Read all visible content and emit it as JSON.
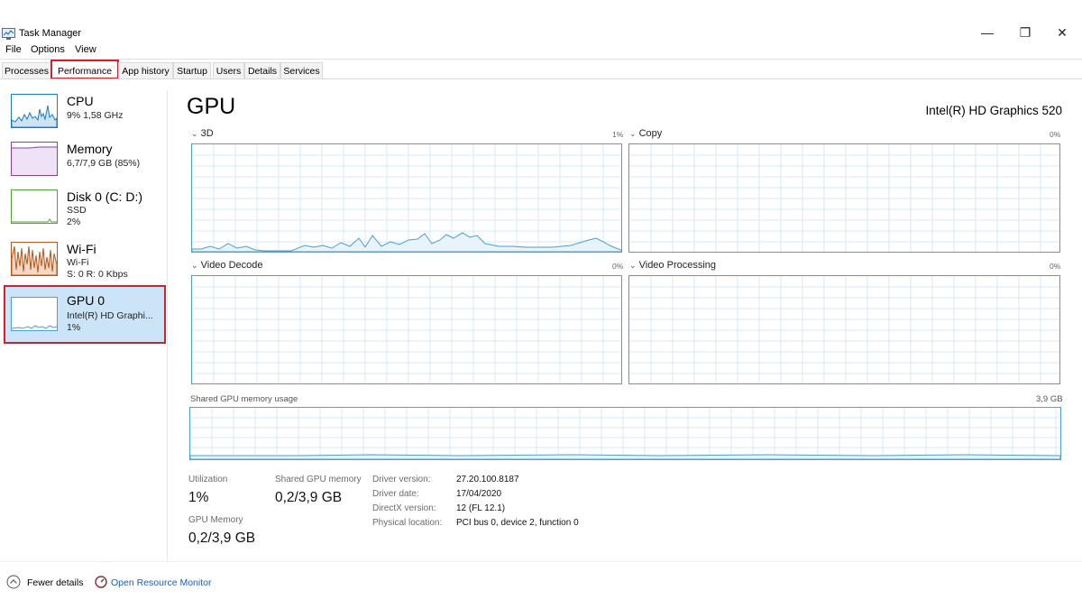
{
  "window": {
    "title": "Task Manager",
    "minimize_glyph": "—",
    "restore_glyph": "❐",
    "close_glyph": "✕"
  },
  "menu": [
    "File",
    "Options",
    "View"
  ],
  "tabs": [
    "Processes",
    "Performance",
    "App history",
    "Startup",
    "Users",
    "Details",
    "Services"
  ],
  "active_tab": "Performance",
  "sidebar": {
    "items": [
      {
        "title": "CPU",
        "line1": "9% 1,58 GHz",
        "line2": ""
      },
      {
        "title": "Memory",
        "line1": "6,7/7,9 GB (85%)",
        "line2": ""
      },
      {
        "title": "Disk 0 (C: D:)",
        "line1": "SSD",
        "line2": "2%"
      },
      {
        "title": "Wi-Fi",
        "line1": "Wi-Fi",
        "line2": "S: 0 R: 0 Kbps"
      },
      {
        "title": "GPU 0",
        "line1": "Intel(R) HD Graphi...",
        "line2": "1%"
      }
    ]
  },
  "main": {
    "title": "GPU",
    "model": "Intel(R) HD Graphics 520",
    "engines": [
      {
        "label": "3D",
        "pct": "1%"
      },
      {
        "label": "Copy",
        "pct": "0%"
      },
      {
        "label": "Video Decode",
        "pct": "0%"
      },
      {
        "label": "Video Processing",
        "pct": "0%"
      }
    ],
    "shared_memory_label": "Shared GPU memory usage",
    "shared_memory_max": "3,9 GB"
  },
  "stats": {
    "utilization_label": "Utilization",
    "utilization_value": "1%",
    "shared_label": "Shared GPU memory",
    "shared_value": "0,2/3,9 GB",
    "gpu_memory_label": "GPU Memory",
    "gpu_memory_value": "0,2/3,9 GB"
  },
  "info": [
    {
      "label": "Driver version:",
      "value": "27.20.100.8187"
    },
    {
      "label": "Driver date:",
      "value": "17/04/2020"
    },
    {
      "label": "DirectX version:",
      "value": "12 (FL 12.1)"
    },
    {
      "label": "Physical location:",
      "value": "PCI bus 0, device 2, function 0"
    }
  ],
  "footer": {
    "fewer_details": "Fewer details",
    "open_resource_monitor": "Open Resource Monitor"
  },
  "colors": {
    "accent_highlight": "#d0222c",
    "gpu_line": "#4a9fd3",
    "cpu_line": "#1a7bbf",
    "memory_line": "#8b3fa8",
    "disk_line": "#4ea72e",
    "wifi_line": "#b5561c",
    "selected_bg": "#cce4f7"
  }
}
